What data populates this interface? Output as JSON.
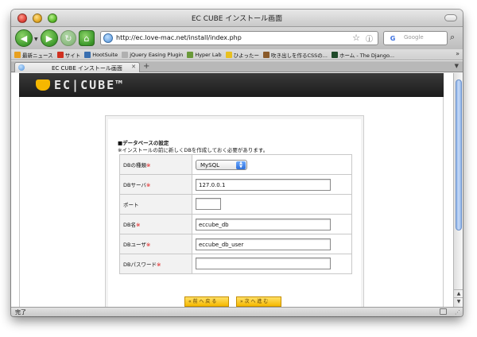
{
  "window": {
    "title": "EC CUBE インストール画面"
  },
  "navbar": {
    "url": "http://ec.love-mac.net/install/index.php",
    "search_placeholder": "Google",
    "search_engine_label": "G"
  },
  "bookmarks": [
    {
      "label": "最新ニュース",
      "color": "#e8a020"
    },
    {
      "label": "サイト",
      "color": "#d03020"
    },
    {
      "label": "HootSuite",
      "color": "#3a6fb0"
    },
    {
      "label": "jQuery Easing Plugin",
      "color": "#b0b0b0"
    },
    {
      "label": "Hyper Lab",
      "color": "#6a9a3a"
    },
    {
      "label": "ひよったー",
      "color": "#e8c020"
    },
    {
      "label": "吹き出しを作るCSSの...",
      "color": "#8a5a2a"
    },
    {
      "label": "ホーム - The Django...",
      "color": "#1f4a2a"
    }
  ],
  "tab": {
    "label": "EC CUBE インストール画面",
    "new_tab_symbol": "+"
  },
  "site": {
    "logo_text": "EC|CUBE™"
  },
  "section": {
    "title": "■データベースの設定",
    "note": "※インストールの前に新しくDBを作成しておく必要があります。"
  },
  "form": {
    "required_mark": "※",
    "rows": {
      "db_type": {
        "label": "DBの種類",
        "required": true,
        "value": "MySQL"
      },
      "db_server": {
        "label": "DBサーバ",
        "required": true,
        "value": "127.0.0.1"
      },
      "port": {
        "label": "ポート",
        "required": false,
        "value": ""
      },
      "db_name": {
        "label": "DB名",
        "required": true,
        "value": "eccube_db"
      },
      "db_user": {
        "label": "DBユーザ",
        "required": true,
        "value": "eccube_db_user"
      },
      "db_password": {
        "label": "DBパスワード",
        "required": true,
        "value": ""
      }
    }
  },
  "buttons": {
    "back": "« 前 へ 戻 る",
    "next": "» 次 へ 進 む"
  },
  "status": {
    "text": "完了"
  },
  "colors": {
    "required": "#e00000",
    "button_yellow": "#f5b800",
    "header_bg": "#2a2a2a",
    "logo_accent": "#f5b700"
  }
}
